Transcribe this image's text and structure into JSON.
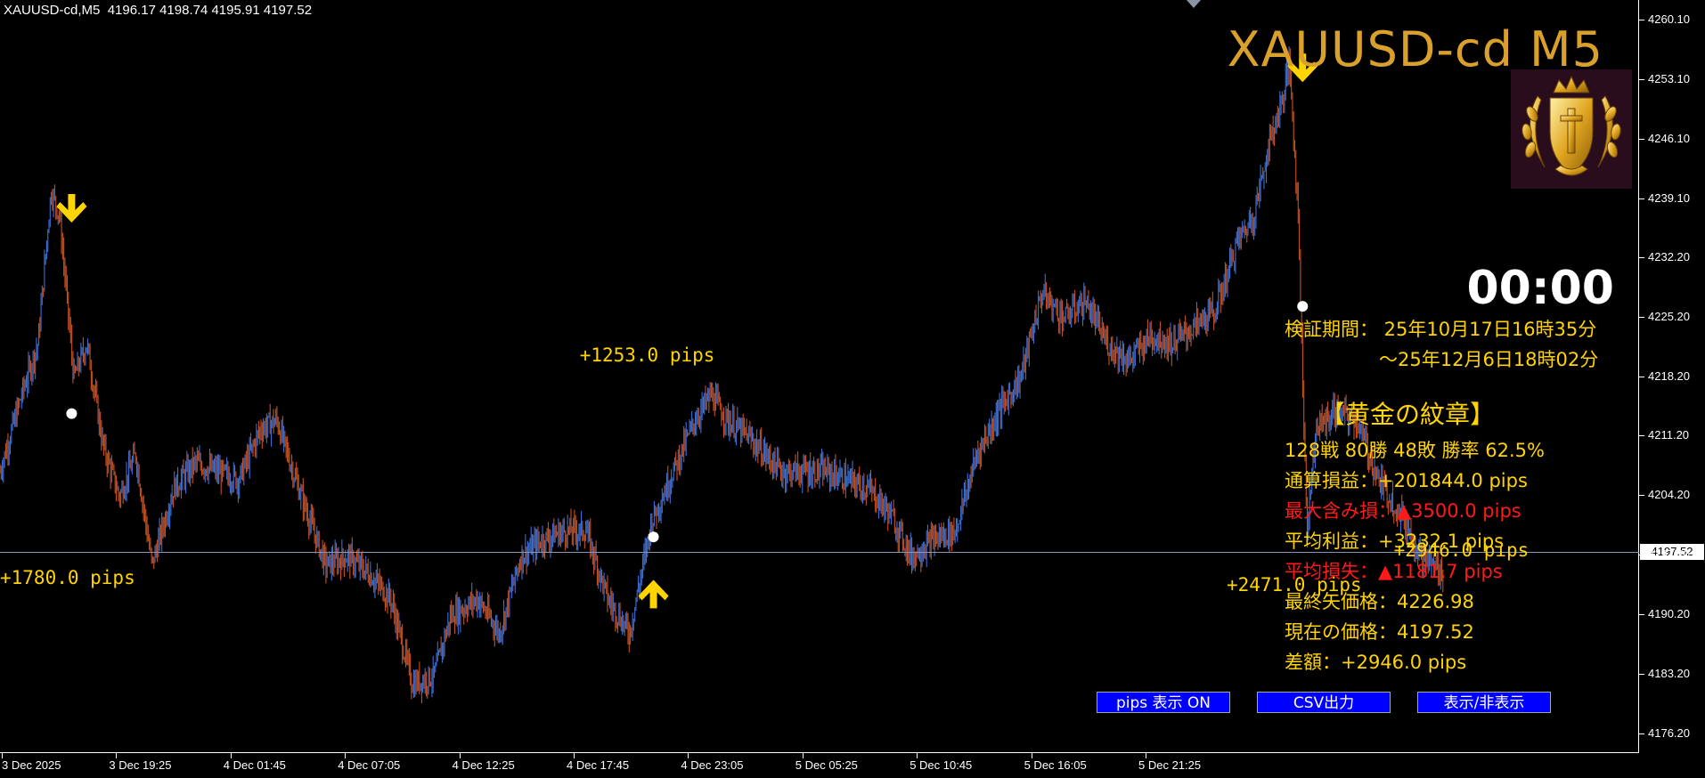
{
  "symbol_info": "XAUUSD-cd,M5  4196.17 4198.74 4195.91 4197.52",
  "big_title": "XAUUSD-cd M5",
  "timer": "00:00",
  "info": {
    "period_label": "検証期間： 25年10月17日16時35分",
    "period_end": "～25年12月6日18時02分",
    "strategy_name": "【黄金の紋章】",
    "record": "128戦 80勝 48敗  勝率 62.5%",
    "total_pl": "通算損益：+201844.0 pips",
    "max_dd": "最大含み損：▲3500.0 pips",
    "avg_profit": "平均利益：+3232.1 pips",
    "avg_loss": "平均損失：▲1181.7 pips",
    "last_arrow_price": "最終矢価格：4226.98",
    "current_price": "現在の価格：4197.52",
    "difference": "差額：+2946.0 pips"
  },
  "buttons": {
    "pips_toggle": "pips 表示 ON",
    "csv_export": "CSV出力",
    "show_hide": "表示/非表示"
  },
  "colors": {
    "up_candle": "#3b6fd6",
    "down_candle": "#c8501e",
    "signal_arrow": "#ffd400",
    "label_yellow": "#ffd400",
    "title_gold": "#d9a12b",
    "loss_red": "#ff1a1a",
    "button_blue": "#0000ff"
  },
  "current_price_tag": "4197.52",
  "chart_data": {
    "type": "candlestick",
    "price_ticks": [
      "4260.10",
      "4253.10",
      "4246.10",
      "4239.10",
      "4232.20",
      "4225.20",
      "4218.20",
      "4211.20",
      "4204.20",
      "4197.20",
      "4190.20",
      "4183.20",
      "4176.20"
    ],
    "time_ticks": [
      "3 Dec 2025",
      "3 Dec 19:25",
      "4 Dec 01:45",
      "4 Dec 07:05",
      "4 Dec 12:25",
      "4 Dec 17:45",
      "4 Dec 23:05",
      "5 Dec 05:25",
      "5 Dec 10:45",
      "5 Dec 16:05",
      "5 Dec 21:25"
    ],
    "ylim": [
      4173.9,
      4262.4
    ],
    "current_price": 4197.52,
    "price_path": [
      [
        0,
        4207
      ],
      [
        20,
        4216
      ],
      [
        35,
        4222
      ],
      [
        47,
        4240
      ],
      [
        55,
        4237
      ],
      [
        68,
        4218
      ],
      [
        80,
        4222
      ],
      [
        95,
        4210
      ],
      [
        110,
        4204
      ],
      [
        125,
        4209
      ],
      [
        140,
        4196
      ],
      [
        160,
        4205
      ],
      [
        180,
        4208
      ],
      [
        200,
        4207
      ],
      [
        220,
        4206
      ],
      [
        240,
        4212
      ],
      [
        255,
        4213
      ],
      [
        275,
        4205
      ],
      [
        300,
        4196
      ],
      [
        320,
        4197
      ],
      [
        340,
        4195
      ],
      [
        360,
        4192
      ],
      [
        380,
        4182
      ],
      [
        400,
        4183
      ],
      [
        415,
        4190
      ],
      [
        440,
        4192
      ],
      [
        460,
        4188
      ],
      [
        480,
        4197
      ],
      [
        500,
        4199
      ],
      [
        520,
        4200
      ],
      [
        540,
        4200
      ],
      [
        560,
        4192
      ],
      [
        580,
        4188
      ],
      [
        600,
        4201
      ],
      [
        620,
        4207
      ],
      [
        640,
        4213
      ],
      [
        655,
        4216
      ],
      [
        670,
        4213
      ],
      [
        690,
        4211
      ],
      [
        720,
        4207
      ],
      [
        740,
        4207
      ],
      [
        760,
        4207
      ],
      [
        780,
        4206
      ],
      [
        800,
        4205
      ],
      [
        820,
        4202
      ],
      [
        840,
        4197
      ],
      [
        860,
        4199
      ],
      [
        880,
        4200
      ],
      [
        900,
        4209
      ],
      [
        920,
        4214
      ],
      [
        940,
        4218
      ],
      [
        960,
        4228
      ],
      [
        980,
        4225
      ],
      [
        1000,
        4227
      ],
      [
        1020,
        4222
      ],
      [
        1040,
        4220
      ],
      [
        1060,
        4223
      ],
      [
        1080,
        4222
      ],
      [
        1100,
        4224
      ],
      [
        1120,
        4226
      ],
      [
        1140,
        4234
      ],
      [
        1155,
        4237
      ],
      [
        1170,
        4246
      ],
      [
        1180,
        4250
      ],
      [
        1188,
        4255
      ],
      [
        1196,
        4237
      ],
      [
        1204,
        4200
      ],
      [
        1212,
        4212
      ],
      [
        1230,
        4214
      ],
      [
        1250,
        4213
      ],
      [
        1270,
        4206
      ],
      [
        1290,
        4202
      ],
      [
        1310,
        4197
      ],
      [
        1330,
        4195
      ]
    ],
    "annotations": [
      {
        "type": "down_arrow",
        "x": 66,
        "price": 4237.5
      },
      {
        "type": "up_arrow",
        "x": 602,
        "price": 4193.0
      },
      {
        "type": "down_arrow",
        "x": 1200,
        "price": 4254.0
      },
      {
        "type": "dot",
        "x": 66,
        "price": 4213.8
      },
      {
        "type": "dot",
        "x": 602,
        "price": 4199.3
      },
      {
        "type": "dot",
        "x": 1200,
        "price": 4226.4
      }
    ],
    "pips_labels": [
      {
        "text": "+1780.0 pips",
        "x": 0,
        "price": 4194.5
      },
      {
        "text": "+1253.0 pips",
        "x": 534,
        "price": 4220.7
      },
      {
        "text": "+2471.0 pips",
        "x": 1130,
        "price": 4193.7
      },
      {
        "text": "+2946.0 pips",
        "x": 1284,
        "price": 4197.8
      }
    ]
  }
}
